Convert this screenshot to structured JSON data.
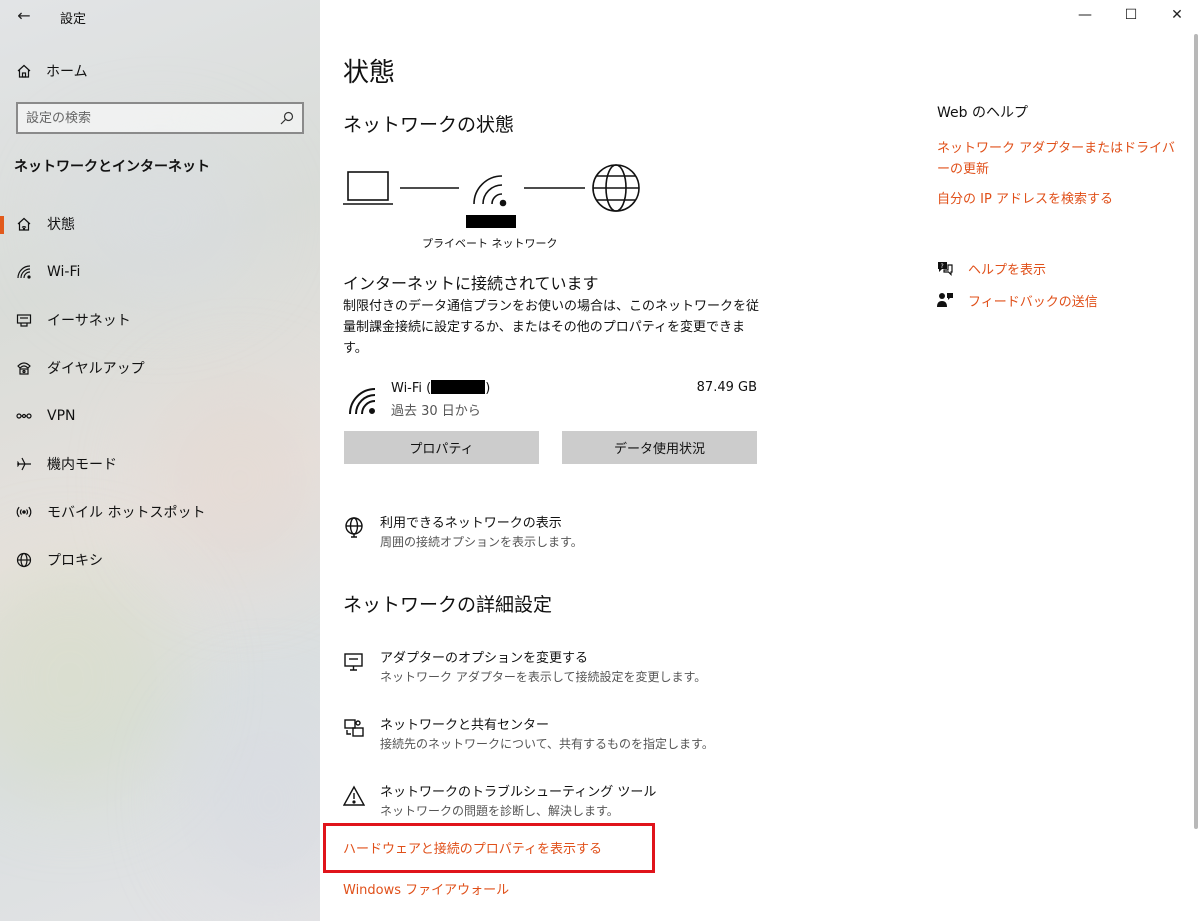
{
  "app": {
    "title": "設定"
  },
  "window": {
    "minimize": "—",
    "maximize": "☐",
    "close": "✕"
  },
  "sidebar": {
    "home_label": "ホーム",
    "search_placeholder": "設定の検索",
    "section_title": "ネットワークとインターネット",
    "items": [
      {
        "label": "状態",
        "icon": "home-network-icon",
        "selected": true
      },
      {
        "label": "Wi-Fi",
        "icon": "wifi-icon",
        "selected": false
      },
      {
        "label": "イーサネット",
        "icon": "ethernet-icon",
        "selected": false
      },
      {
        "label": "ダイヤルアップ",
        "icon": "dialup-icon",
        "selected": false
      },
      {
        "label": "VPN",
        "icon": "vpn-icon",
        "selected": false
      },
      {
        "label": "機内モード",
        "icon": "airplane-icon",
        "selected": false
      },
      {
        "label": "モバイル ホットスポット",
        "icon": "hotspot-icon",
        "selected": false
      },
      {
        "label": "プロキシ",
        "icon": "globe-icon",
        "selected": false
      }
    ],
    "accent_color": "#e25a1c"
  },
  "main": {
    "page_title": "状態",
    "network_status_heading": "ネットワークの状態",
    "network_label": "プライベート ネットワーク",
    "connected_text": "インターネットに接続されています",
    "description": "制限付きのデータ通信プランをお使いの場合は、このネットワークを従量制課金接続に設定するか、またはその他のプロパティを変更できます。",
    "wifi": {
      "name_prefix": "Wi-Fi (",
      "name_suffix": ")",
      "usage": "87.49 GB",
      "period": "過去 30 日から"
    },
    "buttons": {
      "properties": "プロパティ",
      "data_usage": "データ使用状況"
    },
    "show_networks": {
      "title": "利用できるネットワークの表示",
      "subtitle": "周囲の接続オプションを表示します。"
    },
    "advanced_heading": "ネットワークの詳細設定",
    "advanced_items": [
      {
        "title": "アダプターのオプションを変更する",
        "subtitle": "ネットワーク アダプターを表示して接続設定を変更します。"
      },
      {
        "title": "ネットワークと共有センター",
        "subtitle": "接続先のネットワークについて、共有するものを指定します。"
      },
      {
        "title": "ネットワークのトラブルシューティング ツール",
        "subtitle": "ネットワークの問題を診断し、解決します。"
      }
    ],
    "hardware_link": "ハードウェアと接続のプロパティを表示する",
    "firewall_link": "Windows ファイアウォール",
    "link_color": "#e0501a",
    "highlight_color": "#e0141b"
  },
  "help": {
    "title": "Web のヘルプ",
    "links": [
      "ネットワーク アダプターまたはドライバーの更新",
      "自分の IP アドレスを検索する"
    ],
    "get_help": "ヘルプを表示",
    "feedback": "フィードバックの送信"
  }
}
